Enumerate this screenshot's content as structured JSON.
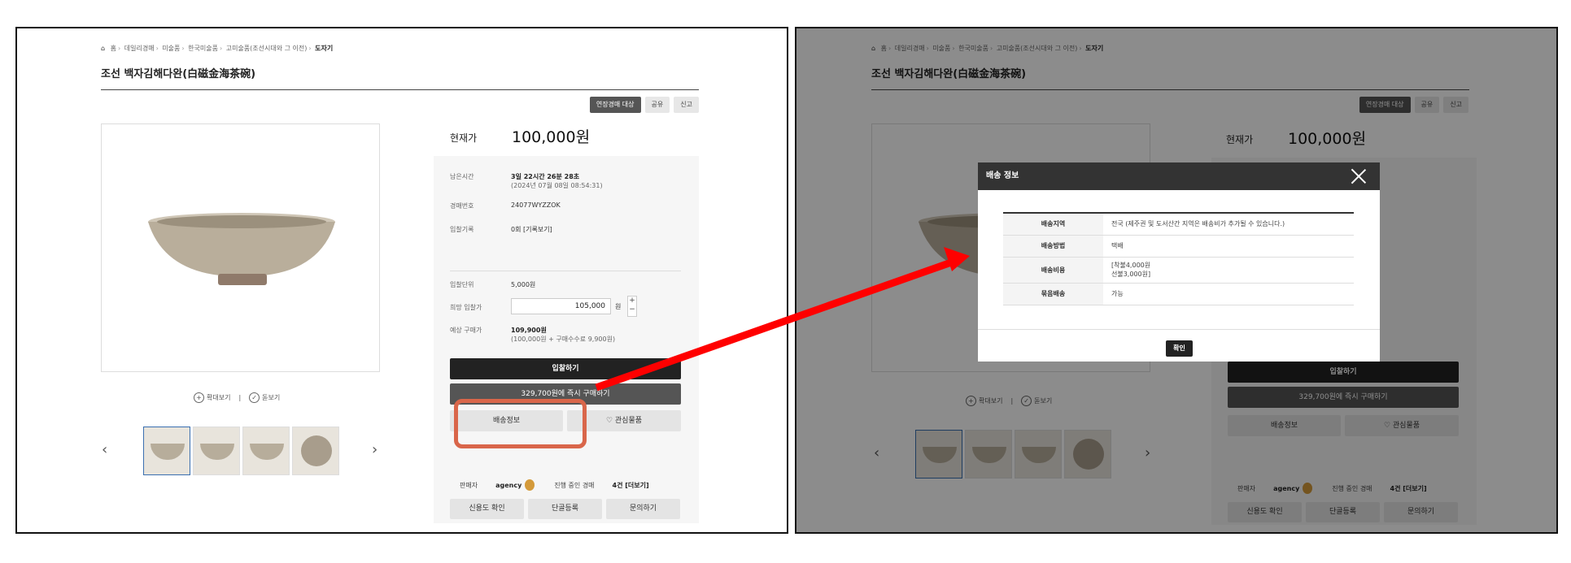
{
  "breadcrumb": {
    "items": [
      "홈",
      "데일리경매",
      "미술품",
      "한국미술품",
      "고미술품(조선시대와 그 이전)"
    ],
    "current": "도자기"
  },
  "product": {
    "title": "조선 백자김해다완(白磁金海茶碗)"
  },
  "tags": {
    "extend": "연장경매 대상",
    "share": "공유",
    "report": "신고"
  },
  "view_links": {
    "zoom": "확대보기",
    "search": "돋보기",
    "divider": "|"
  },
  "price": {
    "label": "현재가",
    "value": "100,000원"
  },
  "details": {
    "time_label": "남은시간",
    "time_value": "3일 22시간 26분 28초",
    "time_sub": "(2024년 07월 08일 08:54:31)",
    "lot_label": "경매번호",
    "lot_value": "24077WYZZOK",
    "bids_label": "입찰기록",
    "bids_value": "0회 [기록보기]",
    "unit_label": "입찰단위",
    "unit_value": "5,000원",
    "hope_label": "희망 입찰가",
    "hope_value": "105,000",
    "won": "원",
    "est_label": "예상 구매가",
    "est_value": "109,900원",
    "est_sub": "(100,000원 + 구매수수료 9,900원)"
  },
  "buttons": {
    "bid": "입찰하기",
    "buy_now": "329,700원에 즉시 구매하기",
    "shipping": "배송정보",
    "wish": "♡ 관심물품",
    "plus": "+",
    "minus": "−"
  },
  "seller": {
    "label": "판매자",
    "name": "agency",
    "ongoing_label": "진행 중인 경매",
    "ongoing_value": "4건 [더보기]",
    "credit": "신용도 확인",
    "fav": "단골등록",
    "ask": "문의하기"
  },
  "modal": {
    "title": "배송 정보",
    "rows": [
      {
        "label": "배송지역",
        "value": "전국 (제주권 및 도서산간 지역은 배송비가 추가될 수 있습니다.)"
      },
      {
        "label": "배송방법",
        "value": "택배"
      },
      {
        "label": "배송비용",
        "value": "[착불4,000원",
        "value2": "선불3,000원]"
      },
      {
        "label": "묶음배송",
        "value": "가능"
      }
    ],
    "ok": "확인"
  },
  "icons": {
    "home": "home-icon",
    "close": "close-icon",
    "arrow": "arrow-icon",
    "medal": "medal-icon"
  },
  "colors": {
    "highlight": "#d9664a",
    "arrow": "#ff0000",
    "dark_button": "#222222"
  }
}
